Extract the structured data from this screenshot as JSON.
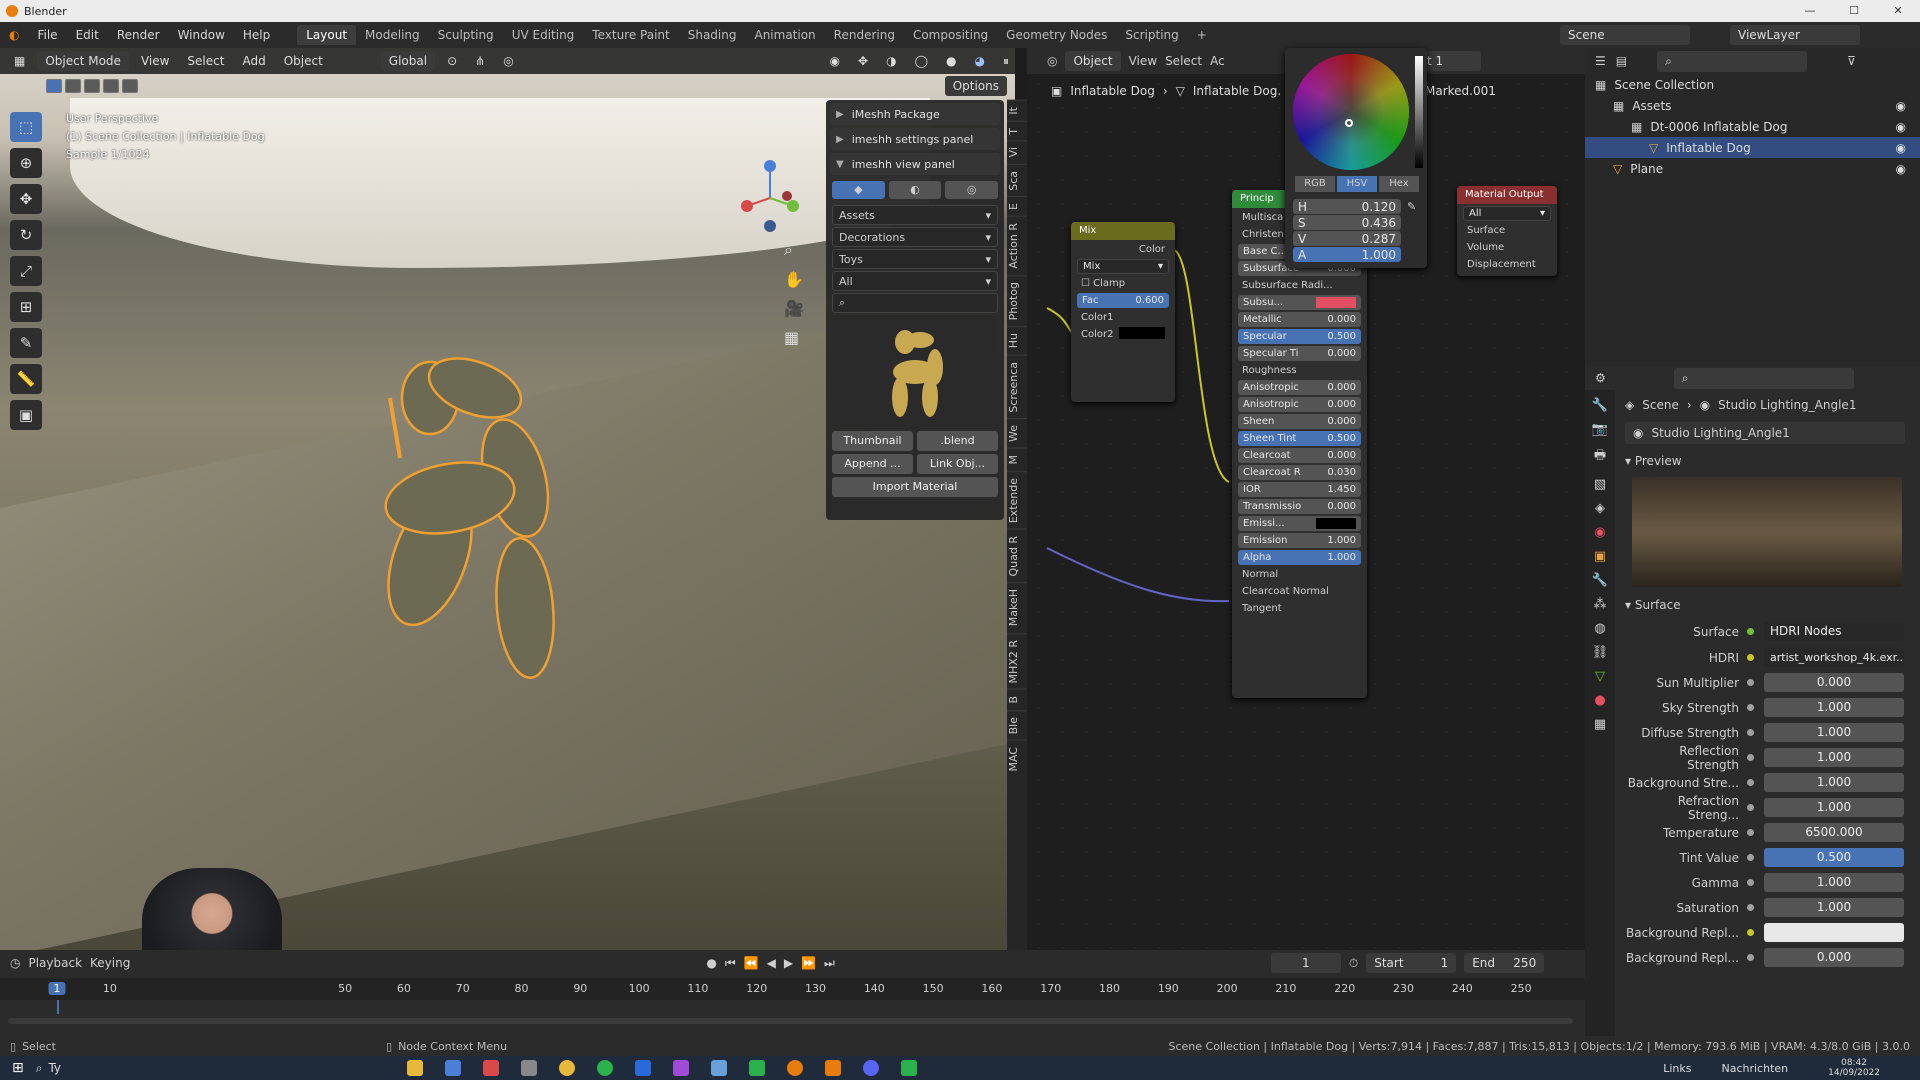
{
  "window": {
    "title": "Blender",
    "controls": [
      "—",
      "☐",
      "✕"
    ]
  },
  "menubar": {
    "menus": [
      "File",
      "Edit",
      "Render",
      "Window",
      "Help"
    ],
    "workspaces": [
      "Layout",
      "Modeling",
      "Sculpting",
      "UV Editing",
      "Texture Paint",
      "Shading",
      "Animation",
      "Rendering",
      "Compositing",
      "Geometry Nodes",
      "Scripting"
    ],
    "active_workspace": "Layout",
    "add_tab": "+",
    "scene": "Scene",
    "view_layer": "ViewLayer"
  },
  "viewport": {
    "mode": "Object Mode",
    "menus": [
      "View",
      "Select",
      "Add",
      "Object"
    ],
    "transform": "Global",
    "options": "Options",
    "info": [
      "User Perspective",
      "(1) Scene Collection | Inflatable Dog",
      "Sample 1/1024"
    ],
    "tools": [
      "select-box",
      "cursor",
      "move",
      "rotate",
      "scale",
      "transform",
      "annotate",
      "measure",
      "add-cube"
    ]
  },
  "npanel": {
    "sections": [
      "iMeshh Package",
      "imeshh settings panel",
      "imeshh view panel"
    ],
    "dropdowns": [
      "Assets",
      "Decorations",
      "Toys",
      "All"
    ],
    "buttons": {
      "thumbnail": "Thumbnail",
      "blend": ".blend",
      "append": "Append ...",
      "link": "Link Obj...",
      "import_material": "Import Material"
    },
    "tabs": [
      "It",
      "T",
      "Vi",
      "Sca",
      "E",
      "Action R",
      "Photog",
      "Hu",
      "Screenca",
      "We",
      "M",
      "Extende",
      "Quad R",
      "MakeH",
      "MHX2 R",
      "B",
      "Ble",
      "MAC"
    ]
  },
  "node_editor": {
    "header": [
      "Object",
      "View",
      "Select",
      "Ac"
    ],
    "slot": "Slot 1",
    "breadcrumb": [
      "Inflatable Dog",
      "Inflatable Dog.",
      "Marked.001"
    ],
    "mix_node": {
      "title": "Mix",
      "output": "Color",
      "blend": "Mix",
      "clamp": "Clamp",
      "fac_label": "Fac",
      "fac_value": "0.600",
      "color1": "Color1",
      "color2": "Color2"
    },
    "principled": {
      "title": "Princip",
      "rows": [
        {
          "l": "Multisca",
          "v": ""
        },
        {
          "l": "Christen",
          "v": ""
        },
        {
          "l": "Base C...",
          "v": ""
        },
        {
          "l": "Subsurface",
          "v": "0.000"
        },
        {
          "l": "Subsurface Radi...",
          "v": ""
        },
        {
          "l": "Subsu...",
          "v": ""
        },
        {
          "l": "Metallic",
          "v": "0.000"
        },
        {
          "l": "Specular",
          "v": "0.500"
        },
        {
          "l": "Specular Ti",
          "v": "0.000"
        },
        {
          "l": "Roughness",
          "v": ""
        },
        {
          "l": "Anisotropic",
          "v": "0.000"
        },
        {
          "l": "Anisotropic",
          "v": "0.000"
        },
        {
          "l": "Sheen",
          "v": "0.000"
        },
        {
          "l": "Sheen Tint",
          "v": "0.500"
        },
        {
          "l": "Clearcoat",
          "v": "0.000"
        },
        {
          "l": "Clearcoat R",
          "v": "0.030"
        },
        {
          "l": "IOR",
          "v": "1.450"
        },
        {
          "l": "Transmissio",
          "v": "0.000"
        },
        {
          "l": "Emissi...",
          "v": ""
        },
        {
          "l": "Emission",
          "v": "1.000"
        },
        {
          "l": "Alpha",
          "v": "1.000"
        },
        {
          "l": "Normal",
          "v": ""
        },
        {
          "l": "Clearcoat Normal",
          "v": ""
        },
        {
          "l": "Tangent",
          "v": ""
        }
      ]
    },
    "material_output": {
      "title": "Material Output",
      "target": "All",
      "sockets": [
        "Surface",
        "Volume",
        "Displacement"
      ]
    }
  },
  "color_picker": {
    "modes": [
      "RGB",
      "HSV",
      "Hex"
    ],
    "active_mode": "HSV",
    "fields": [
      {
        "l": "H",
        "v": "0.120"
      },
      {
        "l": "S",
        "v": "0.436"
      },
      {
        "l": "V",
        "v": "0.287"
      },
      {
        "l": "A",
        "v": "1.000"
      }
    ]
  },
  "outliner": {
    "rows": [
      {
        "label": "Scene Collection",
        "level": 0
      },
      {
        "label": "Assets",
        "level": 1
      },
      {
        "label": "Dt-0006 Inflatable Dog",
        "level": 2
      },
      {
        "label": "Inflatable Dog",
        "level": 3
      },
      {
        "label": "Plane",
        "level": 1
      }
    ]
  },
  "properties": {
    "breadcrumb": [
      "Scene",
      "Studio Lighting_Angle1"
    ],
    "world_name": "Studio Lighting_Angle1",
    "preview_label": "Preview",
    "surface_label": "Surface",
    "surface_row": {
      "label": "Surface",
      "value": "HDRI Nodes"
    },
    "hdri_row": {
      "label": "HDRI",
      "value": "artist_workshop_4k.exr..."
    },
    "rows": [
      {
        "label": "Sun Multiplier",
        "value": "0.000"
      },
      {
        "label": "Sky Strength",
        "value": "1.000"
      },
      {
        "label": "Diffuse Strength",
        "value": "1.000"
      },
      {
        "label": "Reflection Strength",
        "value": "1.000"
      },
      {
        "label": "Background Stre...",
        "value": "1.000"
      },
      {
        "label": "Refraction Streng...",
        "value": "1.000"
      },
      {
        "label": "Temperature",
        "value": "6500.000"
      },
      {
        "label": "Tint Value",
        "value": "0.500"
      },
      {
        "label": "Gamma",
        "value": "1.000"
      },
      {
        "label": "Saturation",
        "value": "1.000"
      },
      {
        "label": "Background Repl...",
        "value": ""
      },
      {
        "label": "Background Repl...",
        "value": "0.000"
      }
    ]
  },
  "timeline": {
    "menus": [
      "Playback",
      "Keying"
    ],
    "current_frame": "1",
    "start_label": "Start",
    "start": "1",
    "end_label": "End",
    "end": "250",
    "ticks": [
      "1",
      "10",
      "50",
      "60",
      "70",
      "80",
      "90",
      "100",
      "110",
      "120",
      "130",
      "140",
      "150",
      "160",
      "170",
      "180",
      "190",
      "200",
      "210",
      "220",
      "230",
      "240",
      "250"
    ]
  },
  "statusbar": {
    "left": "Select",
    "mid": "Node Context Menu",
    "right": "Scene Collection | Inflatable Dog | Verts:7,914 | Faces:7,887 | Tris:15,813 | Objects:1/2 | Memory: 793.6 MiB | VRAM: 4.3/8.0 GiB | 3.0.0"
  },
  "taskbar": {
    "search": "Ty",
    "right_items": [
      "Links",
      "Nachrichten"
    ],
    "time": "08:42",
    "date": "14/09/2022"
  },
  "colors": {
    "accent": "#4772b3",
    "selection": "#e87d0d",
    "subsurface_color": "#e35063"
  }
}
